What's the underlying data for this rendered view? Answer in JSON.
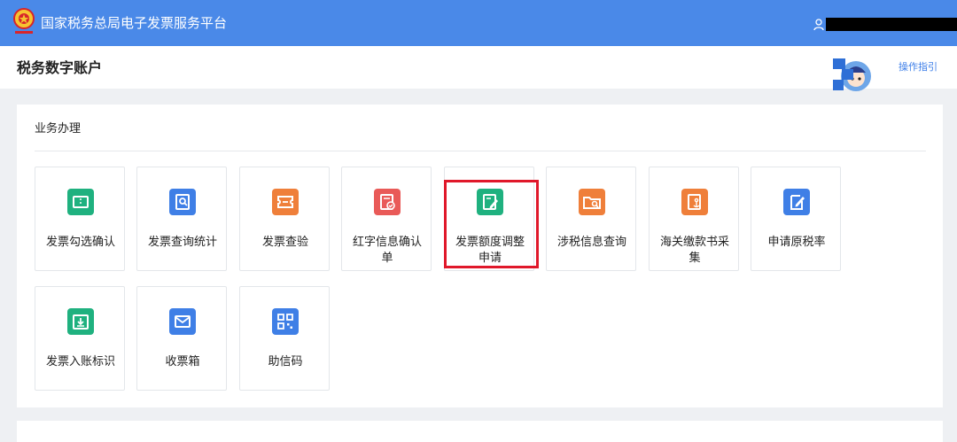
{
  "topbar": {
    "platform_title": "国家税务总局电子发票服务平台",
    "logo_icon": "tax-emblem-icon",
    "user_icon": "user-icon",
    "user_name": ""
  },
  "subheader": {
    "account_title": "税务数字账户",
    "assistant_icon": "tax-assistant-avatar-icon",
    "guide_label": "操作指引"
  },
  "business": {
    "section_title": "业务办理",
    "tiles": [
      {
        "label": "发票勾选确认",
        "icon": "ticket-icon",
        "color": "#1fb17f"
      },
      {
        "label": "发票查询统计",
        "icon": "search-document-icon",
        "color": "#3f7fe6"
      },
      {
        "label": "发票查验",
        "icon": "ticket-check-icon",
        "color": "#ef7f3a"
      },
      {
        "label": "红字信息确认单",
        "icon": "red-form-icon",
        "color": "#e95a58"
      },
      {
        "label": "发票额度调整申请",
        "icon": "edit-document-icon",
        "color": "#1fb17f"
      },
      {
        "label": "涉税信息查询",
        "icon": "folder-search-icon",
        "color": "#ef7f3a"
      },
      {
        "label": "海关缴款书采集",
        "icon": "anchor-document-icon",
        "color": "#ef7f3a"
      },
      {
        "label": "申请原税率",
        "icon": "edit-note-icon",
        "color": "#3f7fe6"
      },
      {
        "label": "发票入账标识",
        "icon": "inbox-download-icon",
        "color": "#1fb17f"
      },
      {
        "label": "收票箱",
        "icon": "mail-icon",
        "color": "#3f7fe6"
      },
      {
        "label": "助信码",
        "icon": "qr-code-icon",
        "color": "#3f7fe6"
      }
    ]
  },
  "highlight_color": "#e0182a"
}
